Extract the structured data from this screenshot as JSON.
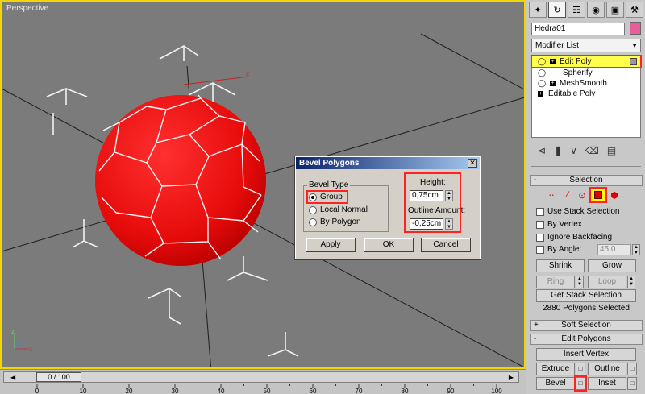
{
  "viewport": {
    "label": "Perspective"
  },
  "timeline": {
    "frame_readout": "0 / 100",
    "prev_icon": "prev-frame-icon",
    "next_icon": "next-frame-icon",
    "ticks": [
      "0",
      "10",
      "20",
      "30",
      "40",
      "50",
      "60",
      "70",
      "80",
      "90",
      "100"
    ]
  },
  "command_panel": {
    "tab_icons": [
      "create-icon",
      "modify-icon",
      "hierarchy-icon",
      "motion-icon",
      "display-icon",
      "utilities-icon"
    ],
    "object_name": "Hedra01",
    "object_color": "#e75f9a",
    "modifier_list_label": "Modifier List",
    "stack": [
      {
        "label": "Edit Poly",
        "selected": true
      },
      {
        "label": "Spherify",
        "selected": false
      },
      {
        "label": "MeshSmooth",
        "selected": false
      },
      {
        "label": "Editable Poly",
        "selected": false
      }
    ],
    "selection_rollout": {
      "title": "Selection",
      "use_stack_selection": "Use Stack Selection",
      "by_vertex": "By Vertex",
      "ignore_backfacing": "Ignore Backfacing",
      "by_angle": "By Angle:",
      "by_angle_value": "45,0",
      "shrink": "Shrink",
      "grow": "Grow",
      "ring": "Ring",
      "loop": "Loop",
      "get_stack_selection": "Get Stack Selection",
      "selected_info": "2880 Polygons Selected"
    },
    "soft_selection_rollout": {
      "title": "Soft Selection"
    },
    "edit_polygons_rollout": {
      "title": "Edit Polygons",
      "insert_vertex": "Insert Vertex",
      "extrude": "Extrude",
      "outline": "Outline",
      "bevel": "Bevel",
      "inset": "Inset"
    }
  },
  "dialog": {
    "title": "Bevel Polygons",
    "bevel_type_label": "Bevel Type",
    "options": [
      "Group",
      "Local Normal",
      "By Polygon"
    ],
    "selected_option": "Group",
    "height_label": "Height:",
    "height_value": "0,75cm",
    "outline_label": "Outline Amount:",
    "outline_value": "-0,25cm",
    "apply": "Apply",
    "ok": "OK",
    "cancel": "Cancel"
  },
  "colors": {
    "ball": "#ee0e0e",
    "viewport_bg": "#7b7b7b",
    "highlight": "#ff2222",
    "active_border": "#f2d600"
  }
}
